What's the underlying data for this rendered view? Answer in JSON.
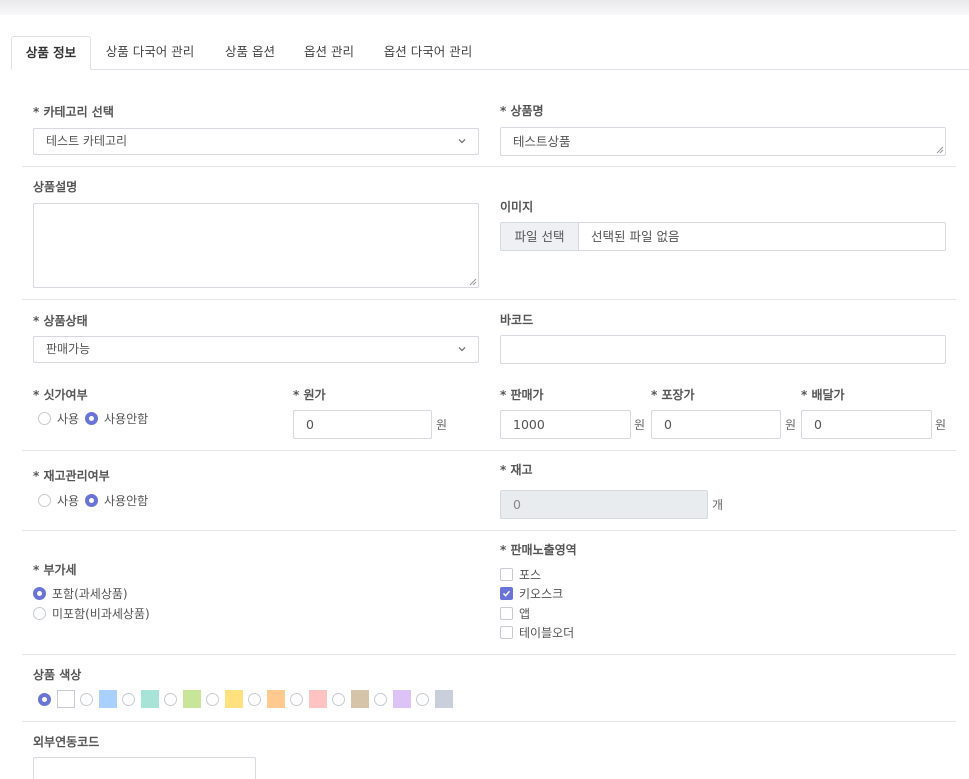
{
  "tabs": [
    "상품 정보",
    "상품 다국어 관리",
    "상품 옵션",
    "옵션 관리",
    "옵션 다국어 관리"
  ],
  "active_tab": 0,
  "category": {
    "label": "* 카테고리 선택",
    "value": "테스트 카테고리",
    "icon": "chevron-down-icon"
  },
  "product_name": {
    "label": "* 상품명",
    "value": "테스트상품"
  },
  "description": {
    "label": "상품설명",
    "value": ""
  },
  "image": {
    "label": "이미지",
    "button": "파일 선택",
    "status": "선택된 파일 없음"
  },
  "status": {
    "label": "* 상품상태",
    "value": "판매가능",
    "icon": "chevron-down-icon"
  },
  "barcode": {
    "label": "바코드",
    "value": ""
  },
  "market_price": {
    "label": "* 싯가여부",
    "options": [
      "사용",
      "사용안함"
    ],
    "selected": 1
  },
  "cost": {
    "label": "* 원가",
    "value": "0",
    "unit": "원"
  },
  "sale_price": {
    "label": "* 판매가",
    "value": "1000",
    "unit": "원"
  },
  "pack_price": {
    "label": "* 포장가",
    "value": "0",
    "unit": "원"
  },
  "delivery_price": {
    "label": "* 배달가",
    "value": "0",
    "unit": "원"
  },
  "stock_mgmt": {
    "label": "* 재고관리여부",
    "options": [
      "사용",
      "사용안함"
    ],
    "selected": 1
  },
  "stock": {
    "label": "* 재고",
    "value": "0",
    "unit": "개"
  },
  "vat": {
    "label": "* 부가세",
    "options": [
      "포함(과세상품)",
      "미포함(비과세상품)"
    ],
    "selected": 0
  },
  "exposure": {
    "label": "* 판매노출영역",
    "options": [
      {
        "label": "포스",
        "checked": false
      },
      {
        "label": "키오스크",
        "checked": true
      },
      {
        "label": "앱",
        "checked": false
      },
      {
        "label": "테이블오더",
        "checked": false
      }
    ]
  },
  "color": {
    "label": "상품 색상",
    "selected": 0,
    "swatches": [
      "#ffffff",
      "#a9d0ff",
      "#a8e3d8",
      "#c9e59a",
      "#ffe27f",
      "#ffc98f",
      "#ffc3c3",
      "#d5c4a8",
      "#dcc2f5",
      "#c9d0db"
    ]
  },
  "external_code": {
    "label": "외부연동코드",
    "value": ""
  },
  "colors": {
    "accent": "#6a74d8",
    "border": "#d6d9de",
    "disabled_bg": "#e9ecef"
  }
}
